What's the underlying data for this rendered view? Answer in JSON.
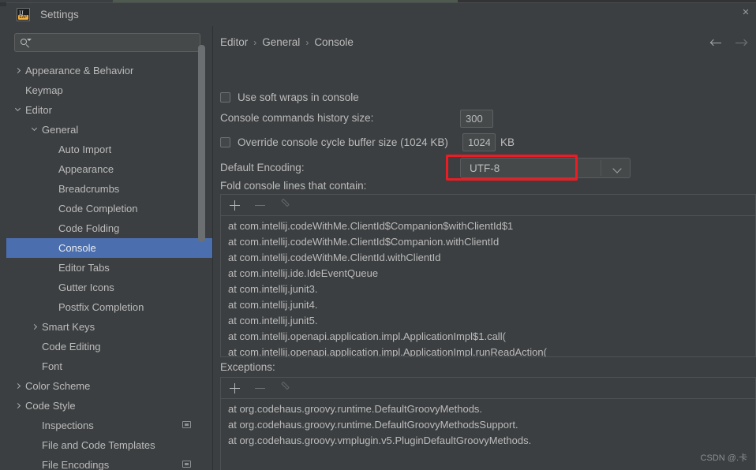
{
  "window": {
    "title": "Settings",
    "logo_top": "IJ",
    "logo_bottom": "EAP",
    "close_icon": "×"
  },
  "sidebar": {
    "search": {
      "value": "",
      "placeholder": "",
      "icon": "search-icon"
    },
    "items": [
      {
        "label": "Appearance & Behavior",
        "indent": 0,
        "arrow": "right",
        "selected": false,
        "badge": false
      },
      {
        "label": "Keymap",
        "indent": 0,
        "arrow": "none",
        "selected": false,
        "badge": false
      },
      {
        "label": "Editor",
        "indent": 0,
        "arrow": "down",
        "selected": false,
        "badge": false
      },
      {
        "label": "General",
        "indent": 1,
        "arrow": "down",
        "selected": false,
        "badge": false
      },
      {
        "label": "Auto Import",
        "indent": 2,
        "arrow": "none",
        "selected": false,
        "badge": false
      },
      {
        "label": "Appearance",
        "indent": 2,
        "arrow": "none",
        "selected": false,
        "badge": false
      },
      {
        "label": "Breadcrumbs",
        "indent": 2,
        "arrow": "none",
        "selected": false,
        "badge": false
      },
      {
        "label": "Code Completion",
        "indent": 2,
        "arrow": "none",
        "selected": false,
        "badge": false
      },
      {
        "label": "Code Folding",
        "indent": 2,
        "arrow": "none",
        "selected": false,
        "badge": false
      },
      {
        "label": "Console",
        "indent": 2,
        "arrow": "none",
        "selected": true,
        "badge": false
      },
      {
        "label": "Editor Tabs",
        "indent": 2,
        "arrow": "none",
        "selected": false,
        "badge": false
      },
      {
        "label": "Gutter Icons",
        "indent": 2,
        "arrow": "none",
        "selected": false,
        "badge": false
      },
      {
        "label": "Postfix Completion",
        "indent": 2,
        "arrow": "none",
        "selected": false,
        "badge": false
      },
      {
        "label": "Smart Keys",
        "indent": 1,
        "arrow": "right",
        "selected": false,
        "badge": false
      },
      {
        "label": "Code Editing",
        "indent": 1,
        "arrow": "none",
        "selected": false,
        "badge": false
      },
      {
        "label": "Font",
        "indent": 1,
        "arrow": "none",
        "selected": false,
        "badge": false
      },
      {
        "label": "Color Scheme",
        "indent": 0,
        "arrow": "right",
        "selected": false,
        "badge": false
      },
      {
        "label": "Code Style",
        "indent": 0,
        "arrow": "right",
        "selected": false,
        "badge": false
      },
      {
        "label": "Inspections",
        "indent": 1,
        "arrow": "none",
        "selected": false,
        "badge": true
      },
      {
        "label": "File and Code Templates",
        "indent": 1,
        "arrow": "none",
        "selected": false,
        "badge": false
      },
      {
        "label": "File Encodings",
        "indent": 1,
        "arrow": "none",
        "selected": false,
        "badge": true
      }
    ]
  },
  "content": {
    "breadcrumb": [
      "Editor",
      "General",
      "Console"
    ],
    "breadcrumb_separator": "›",
    "nav": {
      "back_icon": "arrow-left-icon",
      "forward_icon": "arrow-right-icon"
    },
    "soft_wraps": {
      "label": "Use soft wraps in console",
      "checked": false
    },
    "history_size": {
      "label": "Console commands history size:",
      "value": "300"
    },
    "cycle_buffer": {
      "label": "Override console cycle buffer size (1024 KB)",
      "checked": false,
      "value": "1024",
      "unit": "KB"
    },
    "default_encoding": {
      "label": "Default Encoding:",
      "value": "UTF-8",
      "chevron_icon": "chevron-down-icon",
      "highlight_color": "#ec1c24"
    },
    "fold_section": {
      "label": "Fold console lines that contain:",
      "toolbar": {
        "add": "+",
        "remove": "−",
        "edit": "pencil-icon"
      },
      "items": [
        "at com.intellij.codeWithMe.ClientId$Companion$withClientId$1",
        "at com.intellij.codeWithMe.ClientId$Companion.withClientId",
        "at com.intellij.codeWithMe.ClientId.withClientId",
        "at com.intellij.ide.IdeEventQueue",
        "at com.intellij.junit3.",
        "at com.intellij.junit4.",
        "at com.intellij.junit5.",
        "at com.intellij.openapi.application.impl.ApplicationImpl$1.call(",
        "at com.intellij.openapi.application.impl.ApplicationImpl.runReadAction("
      ]
    },
    "exceptions_section": {
      "label": "Exceptions:",
      "toolbar": {
        "add": "+",
        "remove": "−",
        "edit": "pencil-icon"
      },
      "items": [
        "at org.codehaus.groovy.runtime.DefaultGroovyMethods.",
        "at org.codehaus.groovy.runtime.DefaultGroovyMethodsSupport.",
        "at org.codehaus.groovy.vmplugin.v5.PluginDefaultGroovyMethods."
      ]
    },
    "watermark": "CSDN @.卡"
  },
  "colors": {
    "accent_selection": "#4b6eaf",
    "panel_bg": "#3c3f41",
    "text": "#bbbbbb",
    "highlight": "#ec1c24"
  }
}
